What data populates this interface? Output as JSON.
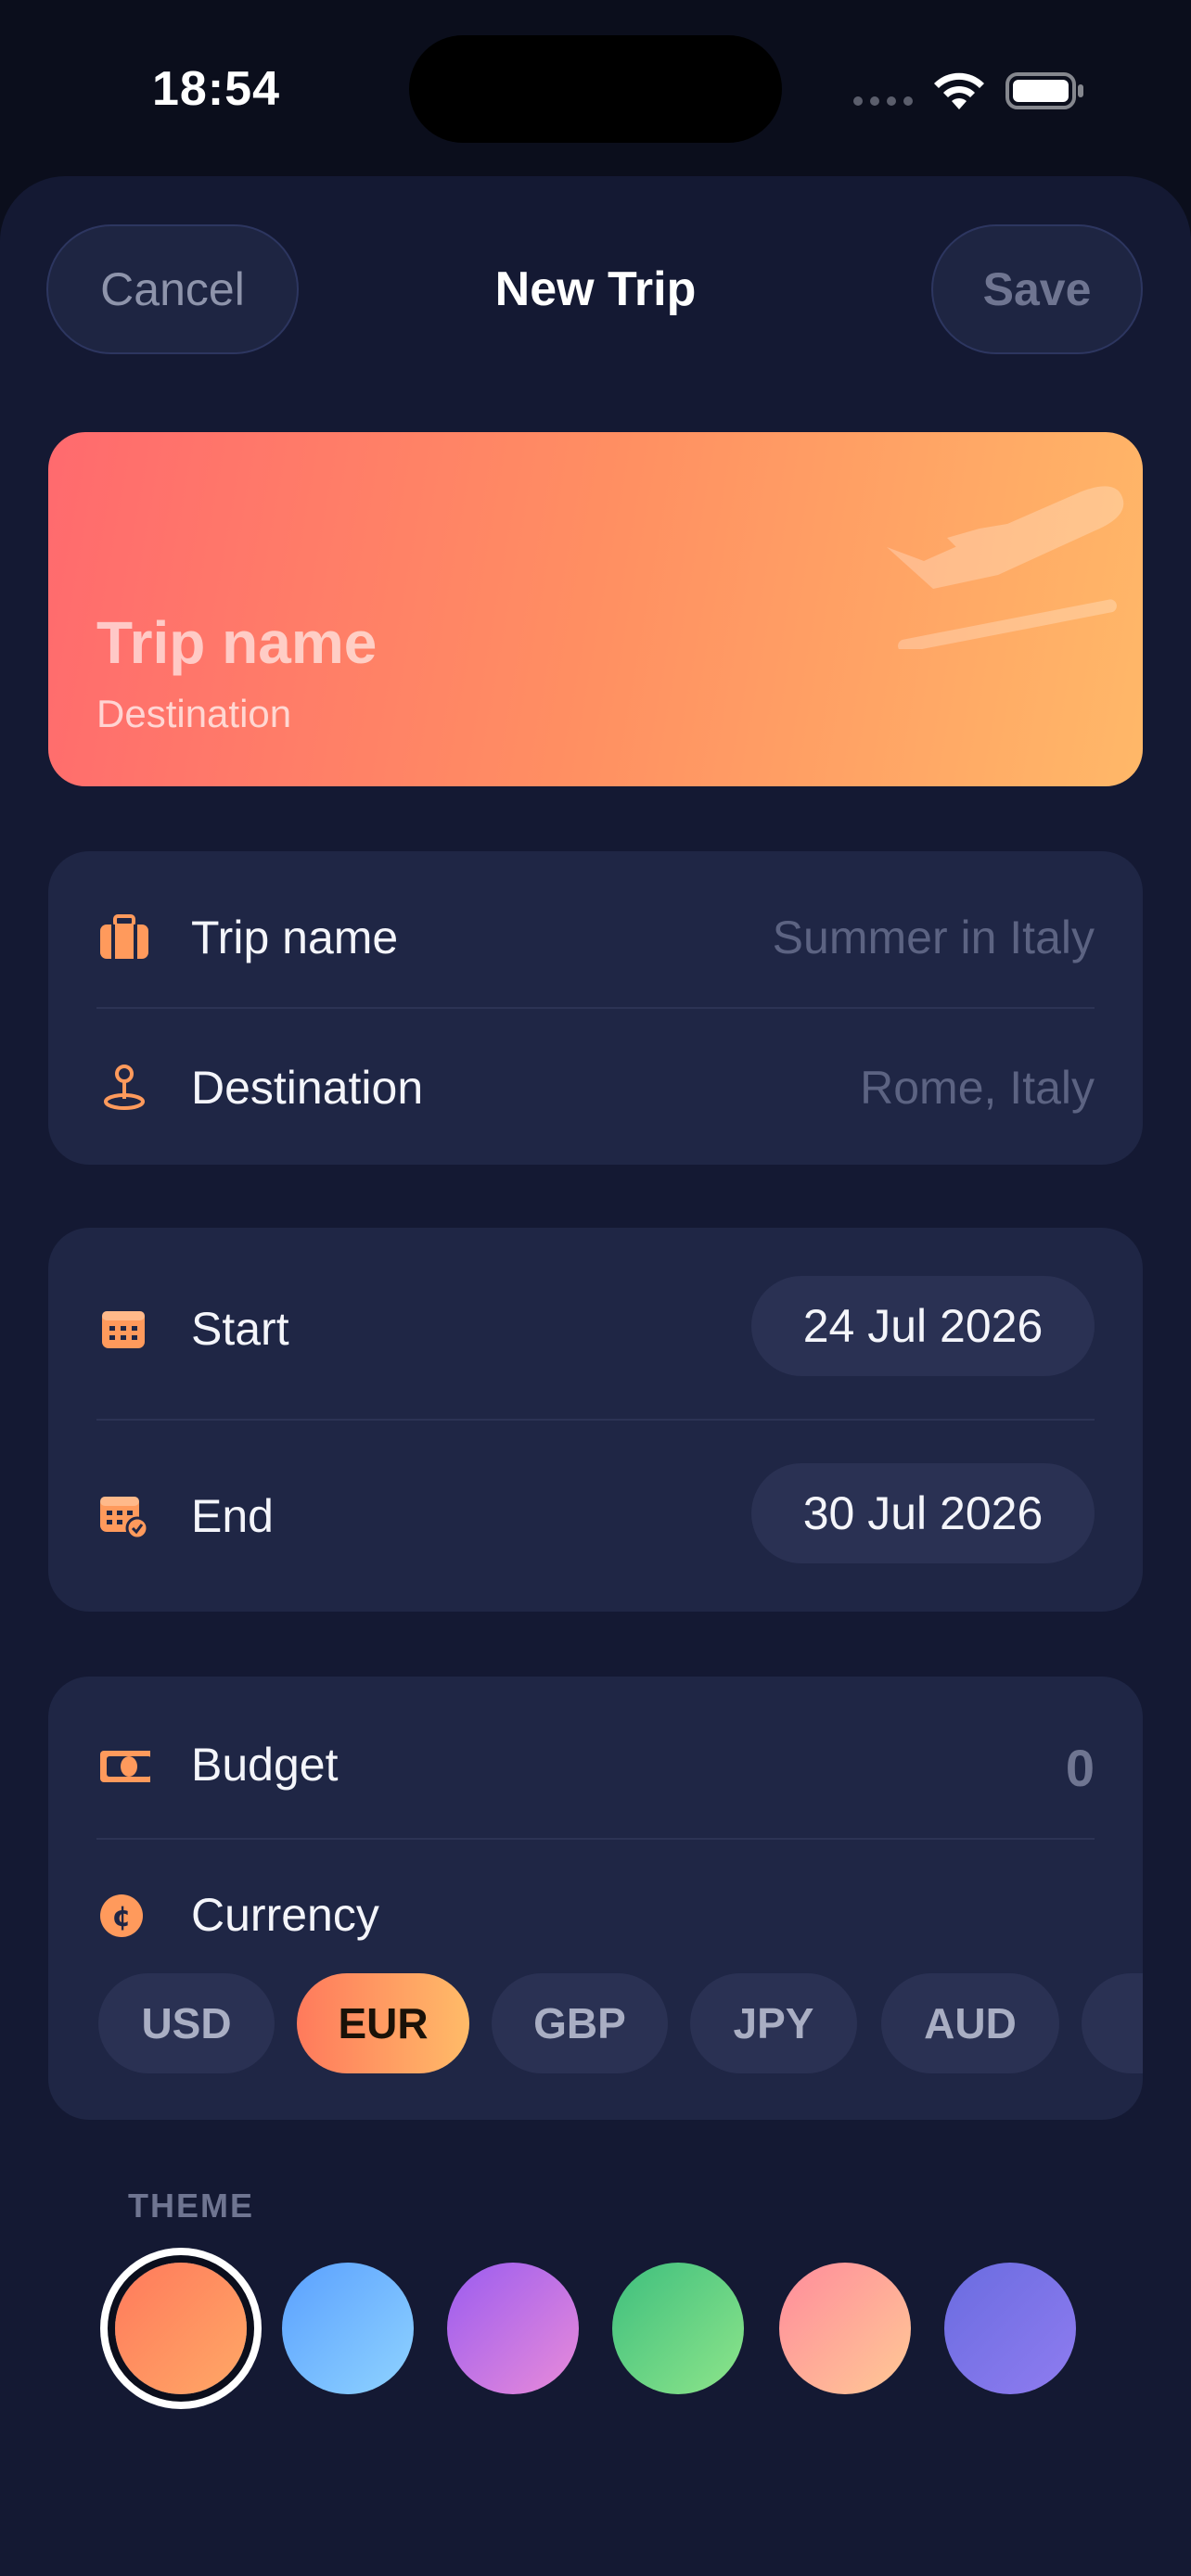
{
  "status_bar": {
    "time": "18:54"
  },
  "nav": {
    "cancel_label": "Cancel",
    "title": "New Trip",
    "save_label": "Save"
  },
  "hero": {
    "title": "Trip name",
    "subtitle": "Destination",
    "icon": "plane-departure-icon"
  },
  "details": {
    "trip_name": {
      "label": "Trip name",
      "placeholder": "Summer in Italy",
      "icon": "suitcase-icon"
    },
    "destination": {
      "label": "Destination",
      "placeholder": "Rome, Italy",
      "icon": "map-pin-icon"
    }
  },
  "dates": {
    "start": {
      "label": "Start",
      "value": "24 Jul 2026",
      "icon": "calendar-icon"
    },
    "end": {
      "label": "End",
      "value": "30 Jul 2026",
      "icon": "calendar-check-icon"
    }
  },
  "money": {
    "budget": {
      "label": "Budget",
      "value": "0",
      "icon": "banknote-icon"
    },
    "currency": {
      "label": "Currency",
      "icon": "currency-coin-icon",
      "selected": "EUR"
    },
    "currencies": [
      "USD",
      "EUR",
      "GBP",
      "JPY",
      "AUD"
    ]
  },
  "theme": {
    "label": "THEME",
    "swatches": [
      {
        "from": "#ff7a5c",
        "to": "#ffa866",
        "selected": true
      },
      {
        "from": "#5aa0ff",
        "to": "#8fd3ff",
        "selected": false
      },
      {
        "from": "#9a5cf0",
        "to": "#e98bd9",
        "selected": false
      },
      {
        "from": "#3ebf7e",
        "to": "#8ee58a",
        "selected": false
      },
      {
        "from": "#ff8c9c",
        "to": "#ffc995",
        "selected": false
      },
      {
        "from": "#6a6ce0",
        "to": "#8f7cf0",
        "selected": false
      }
    ]
  },
  "colors": {
    "accent": "#ff8a5c",
    "background": "#0b0e1c",
    "card": "#1f2645"
  }
}
